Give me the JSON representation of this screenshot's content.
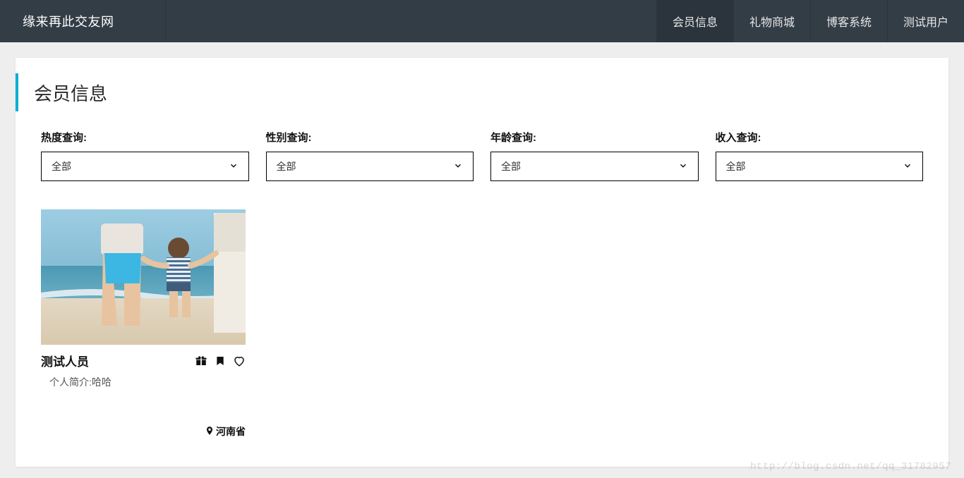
{
  "header": {
    "brand": "缘来再此交友网",
    "nav": [
      {
        "label": "会员信息",
        "active": true
      },
      {
        "label": "礼物商城",
        "active": false
      },
      {
        "label": "博客系统",
        "active": false
      },
      {
        "label": "测试用户",
        "active": false
      }
    ]
  },
  "page": {
    "title": "会员信息"
  },
  "filters": {
    "items": [
      {
        "label": "热度查询:",
        "value": "全部"
      },
      {
        "label": "性别查询:",
        "value": "全部"
      },
      {
        "label": "年龄查询:",
        "value": "全部"
      },
      {
        "label": "收入查询:",
        "value": "全部"
      }
    ]
  },
  "members": [
    {
      "name": "测试人员",
      "intro": "个人简介:哈哈",
      "location": "河南省"
    }
  ],
  "watermark": "http://blog.csdn.net/qq_31782957"
}
